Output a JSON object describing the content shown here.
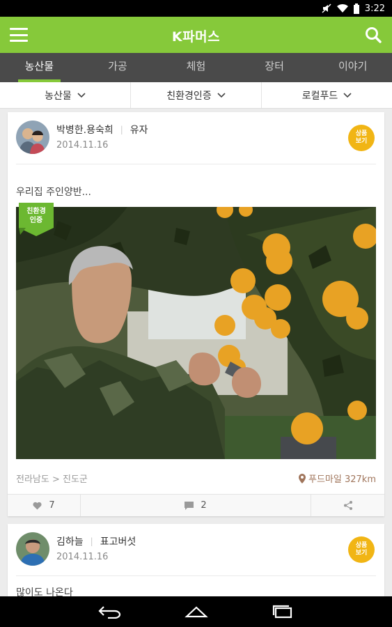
{
  "status": {
    "time": "3:22"
  },
  "header": {
    "title": "K파머스"
  },
  "tabs": [
    {
      "label": "농산물",
      "active": true
    },
    {
      "label": "가공",
      "active": false
    },
    {
      "label": "체험",
      "active": false
    },
    {
      "label": "장터",
      "active": false
    },
    {
      "label": "이야기",
      "active": false
    }
  ],
  "filters": [
    {
      "label": "농산물"
    },
    {
      "label": "친환경인증"
    },
    {
      "label": "로컬푸드"
    }
  ],
  "posts": [
    {
      "author": "박병한.용숙희",
      "product": "유자",
      "date": "2014.11.16",
      "badge": "상품\n보기",
      "text": "우리집 주인양반...",
      "eco_tag": "친환경\n인증",
      "location": "전라남도 > 진도군",
      "distance": "푸드마일 327km",
      "likes": "7",
      "comments": "2"
    },
    {
      "author": "김하늘",
      "product": "표고버섯",
      "date": "2014.11.16",
      "badge": "상품\n보기",
      "text": "많이도 나온다"
    }
  ],
  "colors": {
    "brand": "#86c93a",
    "tabbar": "#4a4a4a",
    "badge": "#f1b514"
  },
  "icons": [
    "menu-icon",
    "search-icon",
    "chevron-down-icon",
    "heart-icon",
    "comment-icon",
    "share-icon",
    "location-pin-icon",
    "back-icon",
    "home-icon",
    "recents-icon"
  ]
}
